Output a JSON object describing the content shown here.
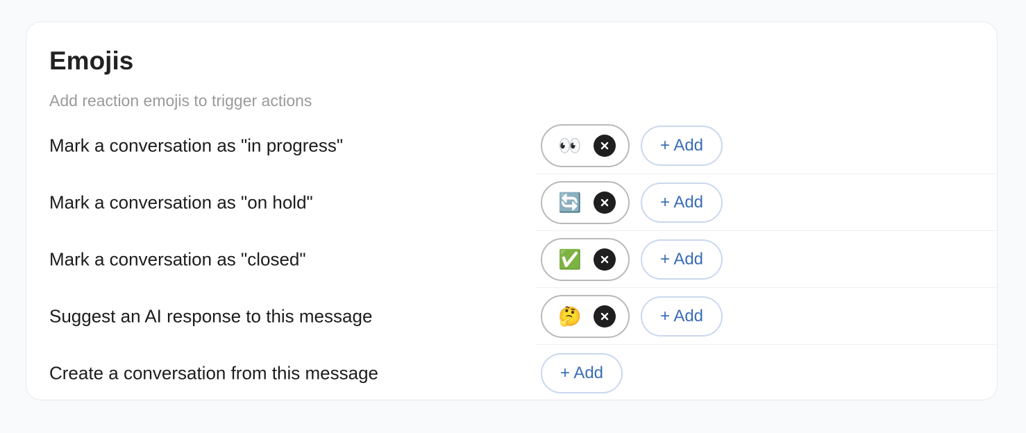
{
  "section": {
    "title": "Emojis",
    "subtitle": "Add reaction emojis to trigger actions"
  },
  "rows": [
    {
      "label": "Mark a conversation as \"in progress\"",
      "emoji": "👀",
      "add_label": "+ Add"
    },
    {
      "label": "Mark a conversation as \"on hold\"",
      "emoji": "🔄",
      "add_label": "+ Add"
    },
    {
      "label": "Mark a conversation as \"closed\"",
      "emoji": "✅",
      "add_label": "+ Add"
    },
    {
      "label": "Suggest an AI response to this message",
      "emoji": "🤔",
      "add_label": "+ Add"
    },
    {
      "label": "Create a conversation from this message",
      "emoji": null,
      "add_label": "+ Add"
    }
  ],
  "icons": {
    "remove": "close-icon"
  },
  "colors": {
    "add_text": "#3a6db5",
    "add_border": "#c9d8ee",
    "chip_border": "#b9b9b9",
    "remove_bg": "#1f1f1f"
  }
}
